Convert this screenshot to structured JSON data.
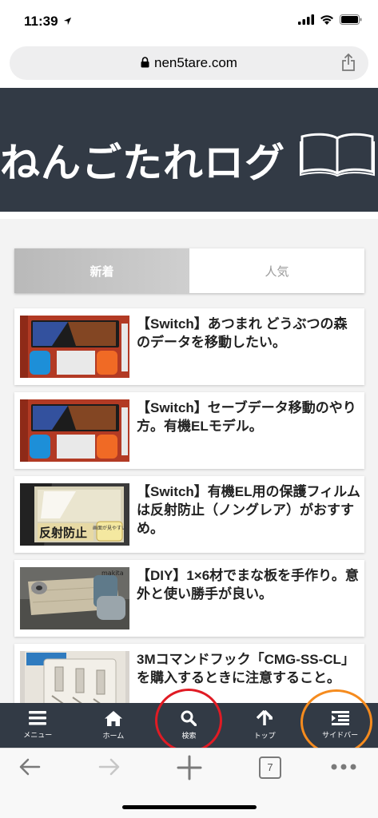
{
  "status": {
    "time": "11:39"
  },
  "browser": {
    "url": "nen5tare.com",
    "tab_count": "7"
  },
  "site": {
    "title": "ねんごたれログ"
  },
  "tabs": {
    "new": "新着",
    "popular": "人気"
  },
  "articles": [
    {
      "title": "【Switch】あつまれ どうぶつの森のデータを移動したい。",
      "thumb": "switch-oled-box"
    },
    {
      "title": "【Switch】セーブデータ移動のやり方。有機ELモデル。",
      "thumb": "switch-oled-box"
    },
    {
      "title": "【Switch】有機EL用の保護フィルムは反射防止（ノングレア）がおすすめ。",
      "thumb": "protective-film-package",
      "thumb_text": "反射防止",
      "thumb_text2": "画面が見やすい"
    },
    {
      "title": "【DIY】1×6材でまな板を手作り。意外と使い勝手が良い。",
      "thumb": "wood-board-diy",
      "thumb_text": "makita"
    },
    {
      "title": "3Mコマンドフック「CMG-SS-CL」を購入するときに注意すること。",
      "thumb": "command-hook-package"
    }
  ],
  "bottom_nav": [
    {
      "label": "メニュー",
      "icon": "menu-icon"
    },
    {
      "label": "ホーム",
      "icon": "home-icon"
    },
    {
      "label": "検索",
      "icon": "search-icon"
    },
    {
      "label": "トップ",
      "icon": "arrow-up-icon"
    },
    {
      "label": "サイドバー",
      "icon": "sidebar-icon"
    }
  ],
  "colors": {
    "header_bg": "#323a45",
    "annotation_red": "#e01b24",
    "annotation_orange": "#f58b1e"
  }
}
